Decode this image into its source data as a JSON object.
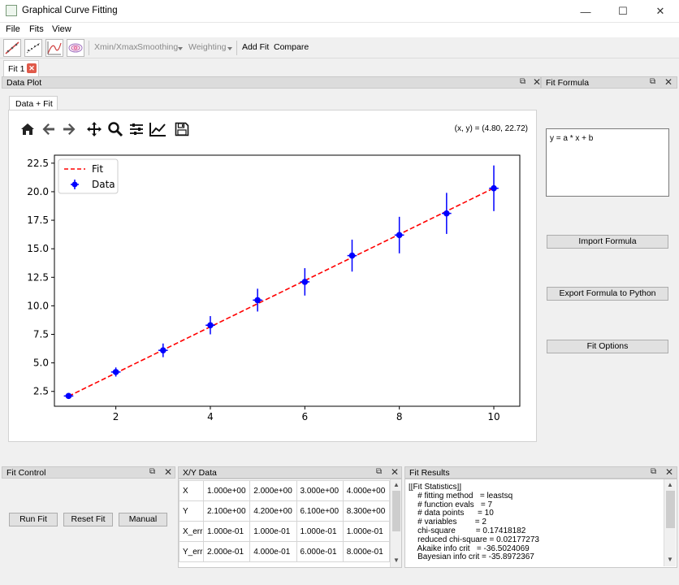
{
  "window": {
    "title": "Graphical Curve Fitting",
    "minimize": "—",
    "maximize": "☐",
    "close": "✕"
  },
  "menu": [
    "File",
    "Fits",
    "View"
  ],
  "toolbar": {
    "xminmax": "Xmin/Xmax",
    "smoothing": "Smoothing",
    "weighting": "Weighting",
    "add_fit": "Add Fit",
    "compare": "Compare",
    "icons": [
      "line-fit-icon",
      "scatter-icon",
      "curve-icon",
      "contour-icon"
    ]
  },
  "doc_tabs": [
    {
      "label": "Fit 1",
      "close": "✕"
    }
  ],
  "data_plot": {
    "title": "Data Plot",
    "tab": "Data + Fit",
    "coords": "(x, y) = (4.80, 22.72)",
    "nav_icons": [
      "home-icon",
      "back-icon",
      "forward-icon",
      "pan-icon",
      "zoom-icon",
      "subplots-icon",
      "axes-edit-icon",
      "save-icon"
    ]
  },
  "fit_formula": {
    "title": "Fit Formula",
    "formula": "y = a * x + b",
    "import_label": "Import Formula",
    "export_label": "Export Formula to Python",
    "options_label": "Fit Options"
  },
  "fit_control": {
    "title": "Fit Control",
    "run_label": "Run Fit",
    "reset_label": "Reset Fit",
    "manual_label": "Manual"
  },
  "xy_data": {
    "title": "X/Y Data",
    "rows": [
      {
        "label": "X",
        "cells": [
          "1.000e+00",
          "2.000e+00",
          "3.000e+00",
          "4.000e+00"
        ]
      },
      {
        "label": "Y",
        "cells": [
          "2.100e+00",
          "4.200e+00",
          "6.100e+00",
          "8.300e+00"
        ]
      },
      {
        "label": "X_err",
        "cells": [
          "1.000e-01",
          "1.000e-01",
          "1.000e-01",
          "1.000e-01"
        ]
      },
      {
        "label": "Y_err",
        "cells": [
          "2.000e-01",
          "4.000e-01",
          "6.000e-01",
          "8.000e-01"
        ]
      }
    ]
  },
  "fit_results": {
    "title": "Fit Results",
    "lines": [
      "[[Fit Statistics]]",
      "    # fitting method   = leastsq",
      "    # function evals   = 7",
      "    # data points      = 10",
      "    # variables        = 2",
      "    chi-square         = 0.17418182",
      "    reduced chi-square = 0.02177273",
      "    Akaike info crit   = -36.5024069",
      "    Bayesian info crit = -35.8972367"
    ]
  },
  "chart_data": {
    "type": "scatter",
    "title": "",
    "xlabel": "",
    "ylabel": "",
    "xlim": [
      0.7,
      10.55
    ],
    "ylim": [
      1.2,
      23.2
    ],
    "xticks": [
      2,
      4,
      6,
      8,
      10
    ],
    "yticks": [
      2.5,
      5.0,
      7.5,
      10.0,
      12.5,
      15.0,
      17.5,
      20.0,
      22.5
    ],
    "grid": false,
    "legend_position": "top-left",
    "series": [
      {
        "name": "Data",
        "x": [
          1,
          2,
          3,
          4,
          5,
          6,
          7,
          8,
          9,
          10
        ],
        "y": [
          2.1,
          4.2,
          6.1,
          8.3,
          10.5,
          12.1,
          14.4,
          16.2,
          18.1,
          20.3
        ],
        "yerr": [
          0.2,
          0.4,
          0.6,
          0.8,
          1.0,
          1.2,
          1.4,
          1.6,
          1.8,
          2.0
        ],
        "xerr": [
          0.1,
          0.1,
          0.1,
          0.1,
          0.1,
          0.1,
          0.1,
          0.1,
          0.1,
          0.1
        ],
        "color": "#0000ff"
      },
      {
        "name": "Fit",
        "x": [
          1,
          10
        ],
        "y": [
          2.08,
          20.32
        ],
        "style": "dashed",
        "color": "#ff0000"
      }
    ]
  }
}
